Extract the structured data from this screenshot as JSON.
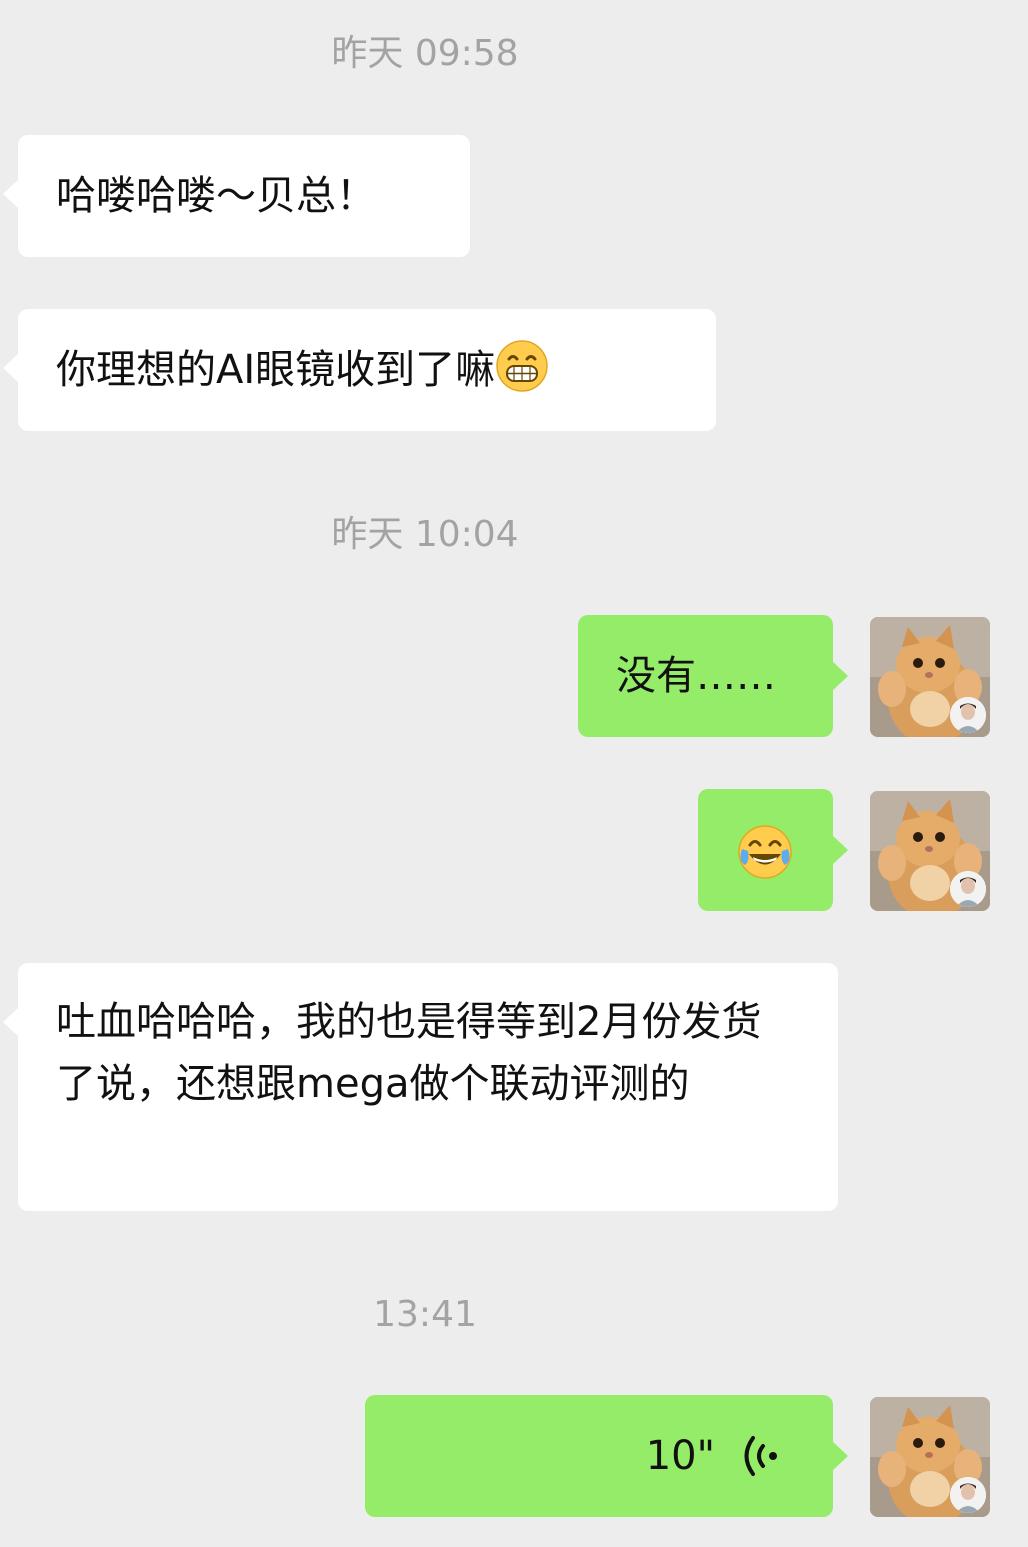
{
  "chat": {
    "timestamps": [
      "昨天 09:58",
      "昨天 10:04",
      "13:41"
    ],
    "messages": [
      {
        "side": "incoming",
        "text": "哈喽哈喽～贝总！"
      },
      {
        "side": "incoming",
        "text": "你理想的AI眼镜收到了嘛",
        "emoji": "grinning-face-emoji"
      },
      {
        "side": "outgoing",
        "text": "没有……"
      },
      {
        "side": "outgoing",
        "emoji": "face-with-tears-of-joy-emoji"
      },
      {
        "side": "incoming",
        "text": "吐血哈哈哈，我的也是得等到2月份发货了说，还想跟mega做个联动评测的"
      },
      {
        "side": "outgoing",
        "type": "voice",
        "duration": "10\""
      }
    ]
  },
  "colors": {
    "background": "#ededed",
    "incoming_bubble": "#ffffff",
    "outgoing_bubble": "#95ec69",
    "timestamp_text": "#a3a3a3"
  },
  "icons": {
    "avatar": "cat-avatar",
    "voice": "voice-wave-icon"
  }
}
